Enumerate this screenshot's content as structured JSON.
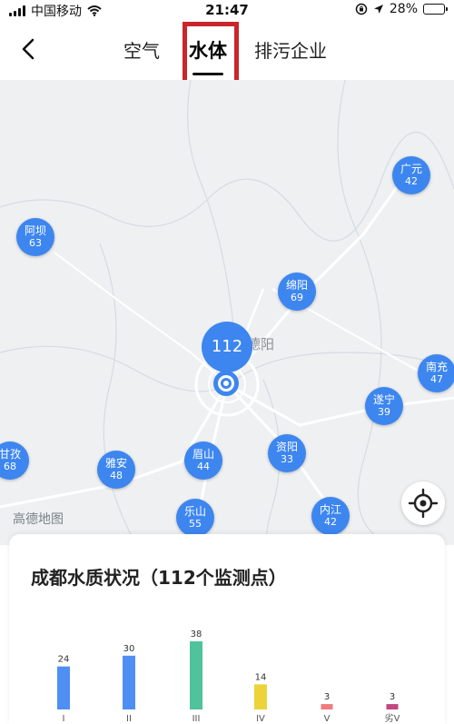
{
  "status_bar": {
    "carrier": "中国移动",
    "time": "21:47",
    "battery": "28%",
    "battery_level": 0.28
  },
  "header": {
    "tabs": [
      {
        "label": "空气",
        "active": false
      },
      {
        "label": "水体",
        "active": true
      },
      {
        "label": "排污企业",
        "active": false
      }
    ],
    "highlight_color": "#c9262c"
  },
  "map": {
    "center_marker": {
      "label": "112"
    },
    "city_label": "德阳",
    "watermark": "高德地图",
    "clusters": [
      {
        "name": "广元",
        "count": "42"
      },
      {
        "name": "阿坝",
        "count": "63"
      },
      {
        "name": "绵阳",
        "count": "69"
      },
      {
        "name": "南充",
        "count": "47"
      },
      {
        "name": "遂宁",
        "count": "39"
      },
      {
        "name": "甘孜",
        "count": "68"
      },
      {
        "name": "雅安",
        "count": "48"
      },
      {
        "name": "眉山",
        "count": "44"
      },
      {
        "name": "资阳",
        "count": "33"
      },
      {
        "name": "乐山",
        "count": "55"
      },
      {
        "name": "内江",
        "count": "42"
      }
    ],
    "marker_color": "#3d86f0"
  },
  "card": {
    "title": "成都水质状况（112个监测点）"
  },
  "chart_data": {
    "type": "bar",
    "categories": [
      "I",
      "II",
      "III",
      "IV",
      "V",
      "劣V"
    ],
    "values": [
      24,
      30,
      38,
      14,
      3,
      3
    ],
    "colors": [
      "#4f8ff4",
      "#4f8ff4",
      "#4fc39b",
      "#ecd33a",
      "#ef7b7b",
      "#c1487d"
    ]
  }
}
